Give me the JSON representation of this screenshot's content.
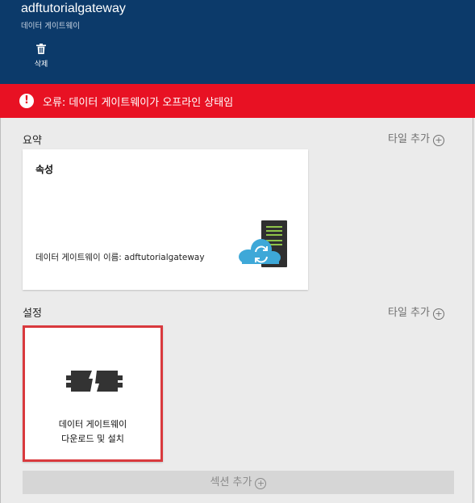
{
  "header": {
    "title": "adftutorialgateway",
    "subtitle": "데이터 게이트웨이",
    "delete_label": "삭제"
  },
  "error": {
    "icon_text": "!",
    "text": "오류: 데이터 게이트웨이가 오프라인 상태임"
  },
  "summary": {
    "label": "요약",
    "add_tile": "타일 추가",
    "tile": {
      "title": "속성",
      "gateway_name": "데이터 게이트웨이 이름: adftutorialgateway",
      "icon": "data-gateway-icon"
    }
  },
  "settings": {
    "label": "설정",
    "add_tile": "타일 추가",
    "tile": {
      "line1": "데이터 게이트웨이",
      "line2": "다운로드 및 설치",
      "icon": "plug-icon"
    }
  },
  "add_section": "섹션 추가",
  "colors": {
    "header_bg": "#0c3a6a",
    "error_bg": "#e81123",
    "page_bg": "#ebebeb",
    "highlight_border": "#d9393d",
    "cloud": "#3ea8d8"
  }
}
